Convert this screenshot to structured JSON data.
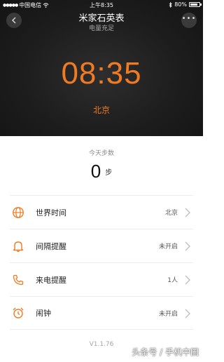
{
  "status_bar": {
    "carrier": "中国电信",
    "time": "上午8:35",
    "battery_percent": "80%",
    "battery_level": 0.8
  },
  "header": {
    "title": "米家石英表",
    "subtitle": "电量充足",
    "clock": "08:35",
    "city": "北京",
    "accent_color": "#f07b22"
  },
  "steps": {
    "label": "今天步数",
    "value": "0",
    "unit": "步"
  },
  "list": [
    {
      "label": "世界时间",
      "value": "北京",
      "icon": "globe-icon"
    },
    {
      "label": "间隔提醒",
      "value": "未开启",
      "icon": "bell-icon"
    },
    {
      "label": "来电提醒",
      "value": "1人",
      "icon": "phone-icon"
    },
    {
      "label": "闹钟",
      "value": "未开启",
      "icon": "alarm-clock-icon"
    }
  ],
  "version": "V1.1.76",
  "watermark": "头条号 / 手机中国"
}
